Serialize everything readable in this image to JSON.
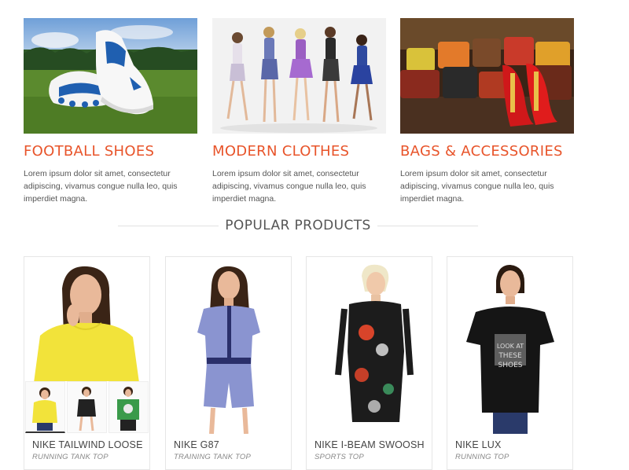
{
  "categories": [
    {
      "title": "FOOTBALL SHOES",
      "text": "Lorem ipsum dolor sit amet, consectetur adipiscing, vivamus congue nulla leo, quis imperdiet magna.",
      "image": "football-shoes-photo"
    },
    {
      "title": "MODERN CLOTHES",
      "text": "Lorem ipsum dolor sit amet, consectetur adipiscing, vivamus congue nulla leo, quis imperdiet magna.",
      "image": "models-in-dresses-photo"
    },
    {
      "title": "BAGS & ACCESSORIES",
      "text": "Lorem ipsum dolor sit amet, consectetur adipiscing, vivamus congue nulla leo, quis imperdiet magna.",
      "image": "bags-and-shoes-photo"
    }
  ],
  "popular": {
    "title": "POPULAR PRODUCTS",
    "products": [
      {
        "name": "NIKE TAILWIND LOOSE",
        "category": "RUNNING TANK TOP",
        "image": "woman-yellow-top-photo"
      },
      {
        "name": "NIKE G87",
        "category": "TRAINING TANK TOP",
        "image": "woman-blue-romper-photo"
      },
      {
        "name": "NIKE I-BEAM SWOOSH",
        "category": "SPORTS TOP",
        "image": "woman-floral-dress-photo"
      },
      {
        "name": "NIKE LUX",
        "category": "RUNNING TOP",
        "image": "woman-black-tshirt-photo"
      }
    ]
  },
  "colors": {
    "accent": "#e8542a",
    "text": "#444444",
    "border": "#e6e6e6"
  }
}
